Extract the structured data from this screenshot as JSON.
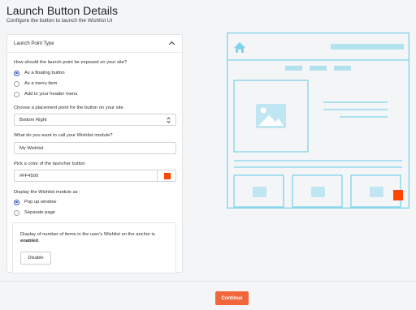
{
  "page": {
    "title": "Launch Button Details",
    "subtitle": "Configure the button to launch the Wishlist UI"
  },
  "panel": {
    "header_label": "Launch Point Type",
    "expanded": true
  },
  "exposure": {
    "question": "How should the launch point be exposed on your site?",
    "options": [
      {
        "label": "As a floating button",
        "selected": true
      },
      {
        "label": "As a menu item",
        "selected": false
      },
      {
        "label": "Add to your header menu",
        "selected": false
      }
    ]
  },
  "placement": {
    "question": "Choose a placement point for the button on your site",
    "selected_value": "Bottom Right"
  },
  "module_name": {
    "question": "What do you want to call your Wishlist module?",
    "value": "My Wishlist"
  },
  "launcher_color": {
    "question": "Pick a color of the launcher button",
    "value": "#FF4500",
    "swatch_color": "#FF4500"
  },
  "display_mode": {
    "question": "Display the Wishlist module as :",
    "options": [
      {
        "label": "Pop up window",
        "selected": true
      },
      {
        "label": "Separate page",
        "selected": false
      }
    ]
  },
  "item_count": {
    "text": "Display of number of items in the user's Wishlist on the anchor is",
    "status": "enabled",
    "status_suffix": ".",
    "button_label": "Disable"
  },
  "preview": {
    "accent_color": "#7fd3ea",
    "launcher_color": "#FF4500",
    "icons": [
      "home-icon",
      "image-icon"
    ]
  },
  "footer": {
    "continue_label": "Continue",
    "continue_color": "#f2663c"
  }
}
